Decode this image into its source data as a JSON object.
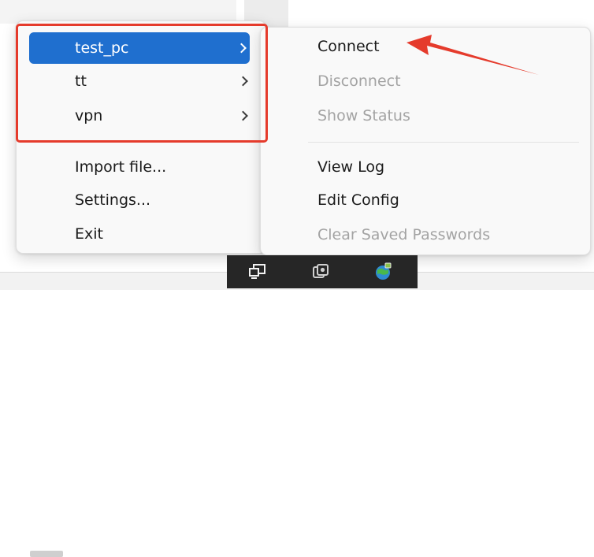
{
  "main_menu": {
    "items": [
      {
        "label": "test_pc",
        "has_submenu": true,
        "selected": true
      },
      {
        "label": "tt",
        "has_submenu": true
      },
      {
        "label": "vpn",
        "has_submenu": true
      },
      {
        "label": "Import file..."
      },
      {
        "label": "Settings..."
      },
      {
        "label": "Exit"
      }
    ]
  },
  "submenu": {
    "items": [
      {
        "label": "Connect",
        "enabled": true
      },
      {
        "label": "Disconnect",
        "enabled": false
      },
      {
        "label": "Show Status",
        "enabled": false
      },
      {
        "label": "View Log",
        "enabled": true
      },
      {
        "label": "Edit Config",
        "enabled": true
      },
      {
        "label": "Clear Saved Passwords",
        "enabled": false
      }
    ]
  },
  "annotations": {
    "highlight_color": "#e53b2c"
  },
  "colors": {
    "selection": "#1f6fcf",
    "disabled_text": "#a3a3a3",
    "taskbar": "#262626"
  },
  "tray_icons": [
    "network-monitor-icon",
    "copy-windows-icon",
    "openvpn-globe-icon"
  ]
}
